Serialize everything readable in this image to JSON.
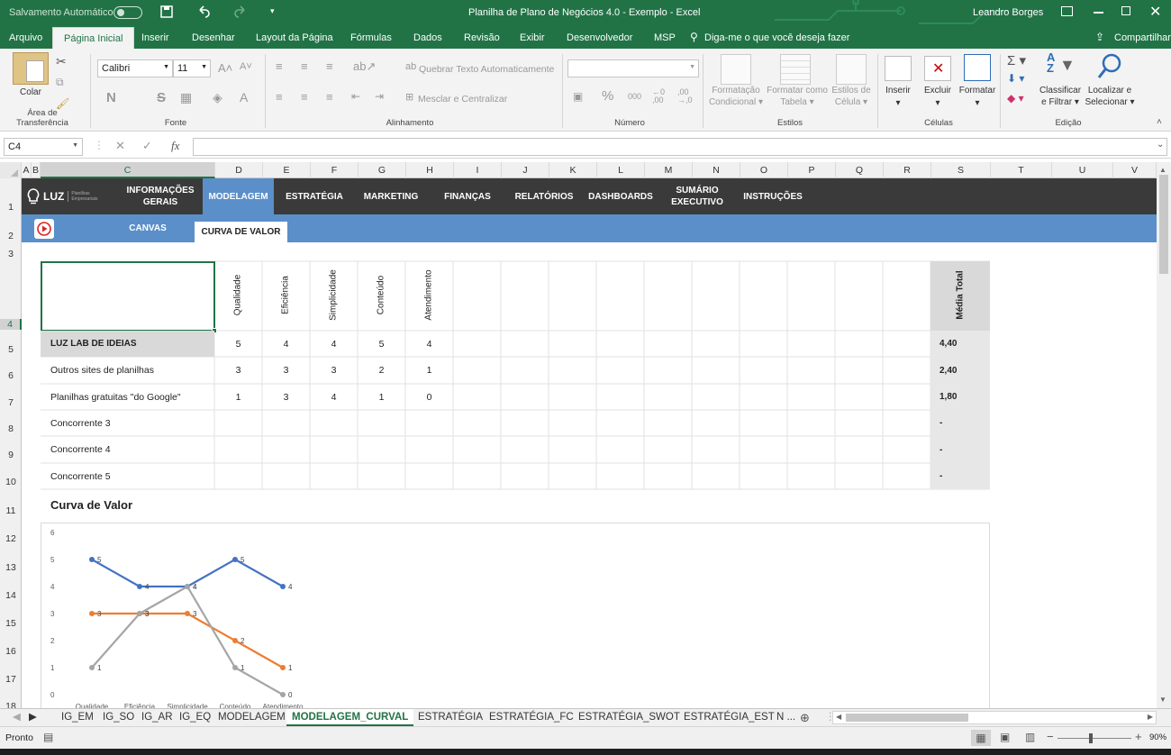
{
  "window": {
    "autosave_label": "Salvamento Automático",
    "title": "Planilha de Plano de Negócios 4.0 - Exemplo  -  Excel",
    "user": "Leandro Borges"
  },
  "ribbon_tabs": [
    "Arquivo",
    "Página Inicial",
    "Inserir",
    "Desenhar",
    "Layout da Página",
    "Fórmulas",
    "Dados",
    "Revisão",
    "Exibir",
    "Desenvolvedor",
    "MSP"
  ],
  "tell_me": "Diga-me o que você deseja fazer",
  "share": "Compartilhar",
  "ribbon": {
    "paste": "Colar",
    "clipboard_label": "Área de Transferência",
    "font_name": "Calibri",
    "font_size": "11",
    "bold": "N",
    "strike": "S",
    "font_label": "Fonte",
    "wrap_text": "Quebrar Texto Automaticamente",
    "merge_center": "Mesclar e Centralizar",
    "alignment_label": "Alinhamento",
    "number_label": "Número",
    "cond_format_1": "Formatação",
    "cond_format_2": "Condicional",
    "format_table_1": "Formatar como",
    "format_table_2": "Tabela",
    "cell_styles_1": "Estilos de",
    "cell_styles_2": "Célula",
    "styles_label": "Estilos",
    "insert": "Inserir",
    "delete": "Excluir",
    "format": "Formatar",
    "cells_label": "Células",
    "sort_1": "Classificar",
    "sort_2": "e Filtrar",
    "find_1": "Localizar e",
    "find_2": "Selecionar",
    "editing_label": "Edição"
  },
  "formula_bar": {
    "name_box": "C4",
    "fx": "fx",
    "formula": ""
  },
  "columns": [
    "A",
    "B",
    "C",
    "D",
    "E",
    "F",
    "G",
    "H",
    "I",
    "J",
    "K",
    "L",
    "M",
    "N",
    "O",
    "P",
    "Q",
    "R",
    "S",
    "T",
    "U",
    "V"
  ],
  "rows": [
    "1",
    "2",
    "3",
    "4",
    "5",
    "6",
    "7",
    "8",
    "9",
    "10",
    "11",
    "12",
    "13",
    "14",
    "15",
    "16",
    "17",
    "18"
  ],
  "nav": {
    "brand": "LUZ",
    "brand_sub": "Planilhas Empresariais",
    "items": [
      "INFORMAÇÕES GERAIS",
      "MODELAGEM",
      "ESTRATÉGIA",
      "MARKETING",
      "FINANÇAS",
      "RELATÓRIOS",
      "DASHBOARDS",
      "SUMÁRIO EXECUTIVO",
      "INSTRUÇÕES"
    ],
    "sub_items": [
      "CANVAS",
      "CURVA DE VALOR"
    ]
  },
  "table": {
    "criteria": [
      "Qualidade",
      "Eficiência",
      "Simplicidade",
      "Conteúdo",
      "Atendimento"
    ],
    "avg_header": "Média Total",
    "rows": [
      {
        "name": "LUZ LAB DE IDEIAS",
        "scores": [
          "5",
          "4",
          "4",
          "5",
          "4"
        ],
        "avg": "4,40"
      },
      {
        "name": "Outros sites de planilhas",
        "scores": [
          "3",
          "3",
          "3",
          "2",
          "1"
        ],
        "avg": "2,40"
      },
      {
        "name": "Planilhas gratuitas \"do Google\"",
        "scores": [
          "1",
          "3",
          "4",
          "1",
          "0"
        ],
        "avg": "1,80"
      },
      {
        "name": "Concorrente 3",
        "scores": [
          "",
          "",
          "",
          "",
          ""
        ],
        "avg": "-"
      },
      {
        "name": "Concorrente 4",
        "scores": [
          "",
          "",
          "",
          "",
          ""
        ],
        "avg": "-"
      },
      {
        "name": "Concorrente 5",
        "scores": [
          "",
          "",
          "",
          "",
          ""
        ],
        "avg": "-"
      }
    ]
  },
  "chart_heading": "Curva de Valor",
  "chart_data": {
    "type": "line",
    "categories": [
      "Qualidade",
      "Eficiência",
      "Simplicidade",
      "Conteúdo",
      "Atendimento"
    ],
    "series": [
      {
        "values": [
          5,
          4,
          4,
          5,
          4
        ],
        "color": "#4472c4"
      },
      {
        "values": [
          3,
          3,
          3,
          2,
          1
        ],
        "color": "#ed7d31"
      },
      {
        "values": [
          1,
          3,
          4,
          1,
          0
        ],
        "color": "#a5a5a5"
      }
    ],
    "ylim": [
      0,
      6
    ],
    "yticks": [
      "0",
      "1",
      "2",
      "3",
      "4",
      "5",
      "6"
    ],
    "grid": false,
    "legend": "none"
  },
  "sheet_tabs": [
    "IG_EM",
    "IG_SO",
    "IG_AR",
    "IG_EQ",
    "MODELAGEM",
    "MODELAGEM_CURVAL",
    "ESTRATÉGIA",
    "ESTRATÉGIA_FC",
    "ESTRATÉGIA_SWOT",
    "ESTRATÉGIA_EST",
    "N ..."
  ],
  "active_sheet": "MODELAGEM_CURVAL",
  "status": {
    "ready": "Pronto",
    "zoom": "90%"
  }
}
